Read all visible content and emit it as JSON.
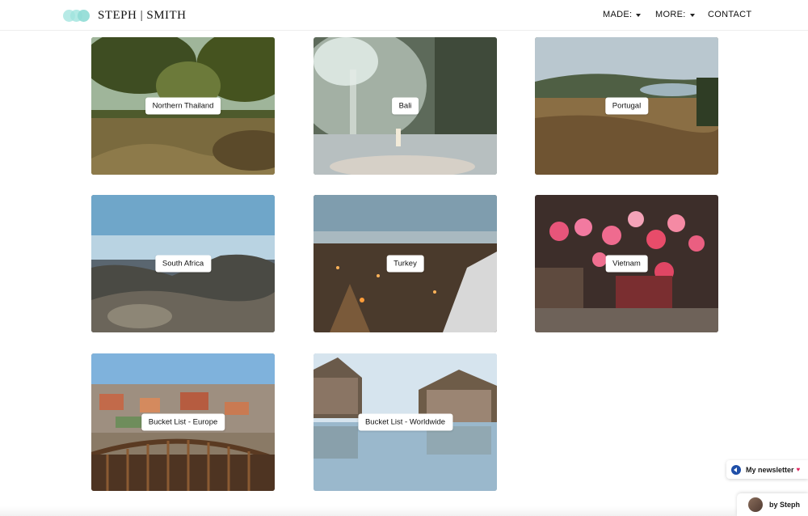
{
  "header": {
    "logo_text": "STEPH | SMITH",
    "nav": [
      {
        "label": "MADE:",
        "dropdown": true
      },
      {
        "label": "MORE:",
        "dropdown": true
      },
      {
        "label": "CONTACT",
        "dropdown": false
      }
    ]
  },
  "gallery": [
    {
      "label": "Northern Thailand"
    },
    {
      "label": "Bali"
    },
    {
      "label": "Portugal"
    },
    {
      "label": "South Africa"
    },
    {
      "label": "Turkey"
    },
    {
      "label": "Vietnam"
    },
    {
      "label": "Bucket List - Europe"
    },
    {
      "label": "Bucket List - Worldwide"
    }
  ],
  "widgets": {
    "newsletter_label": "My newsletter",
    "byline_label": "by Steph"
  },
  "colors": {
    "logo_accent": "#9fe3dd",
    "newsletter_icon": "#1f4fa8"
  }
}
